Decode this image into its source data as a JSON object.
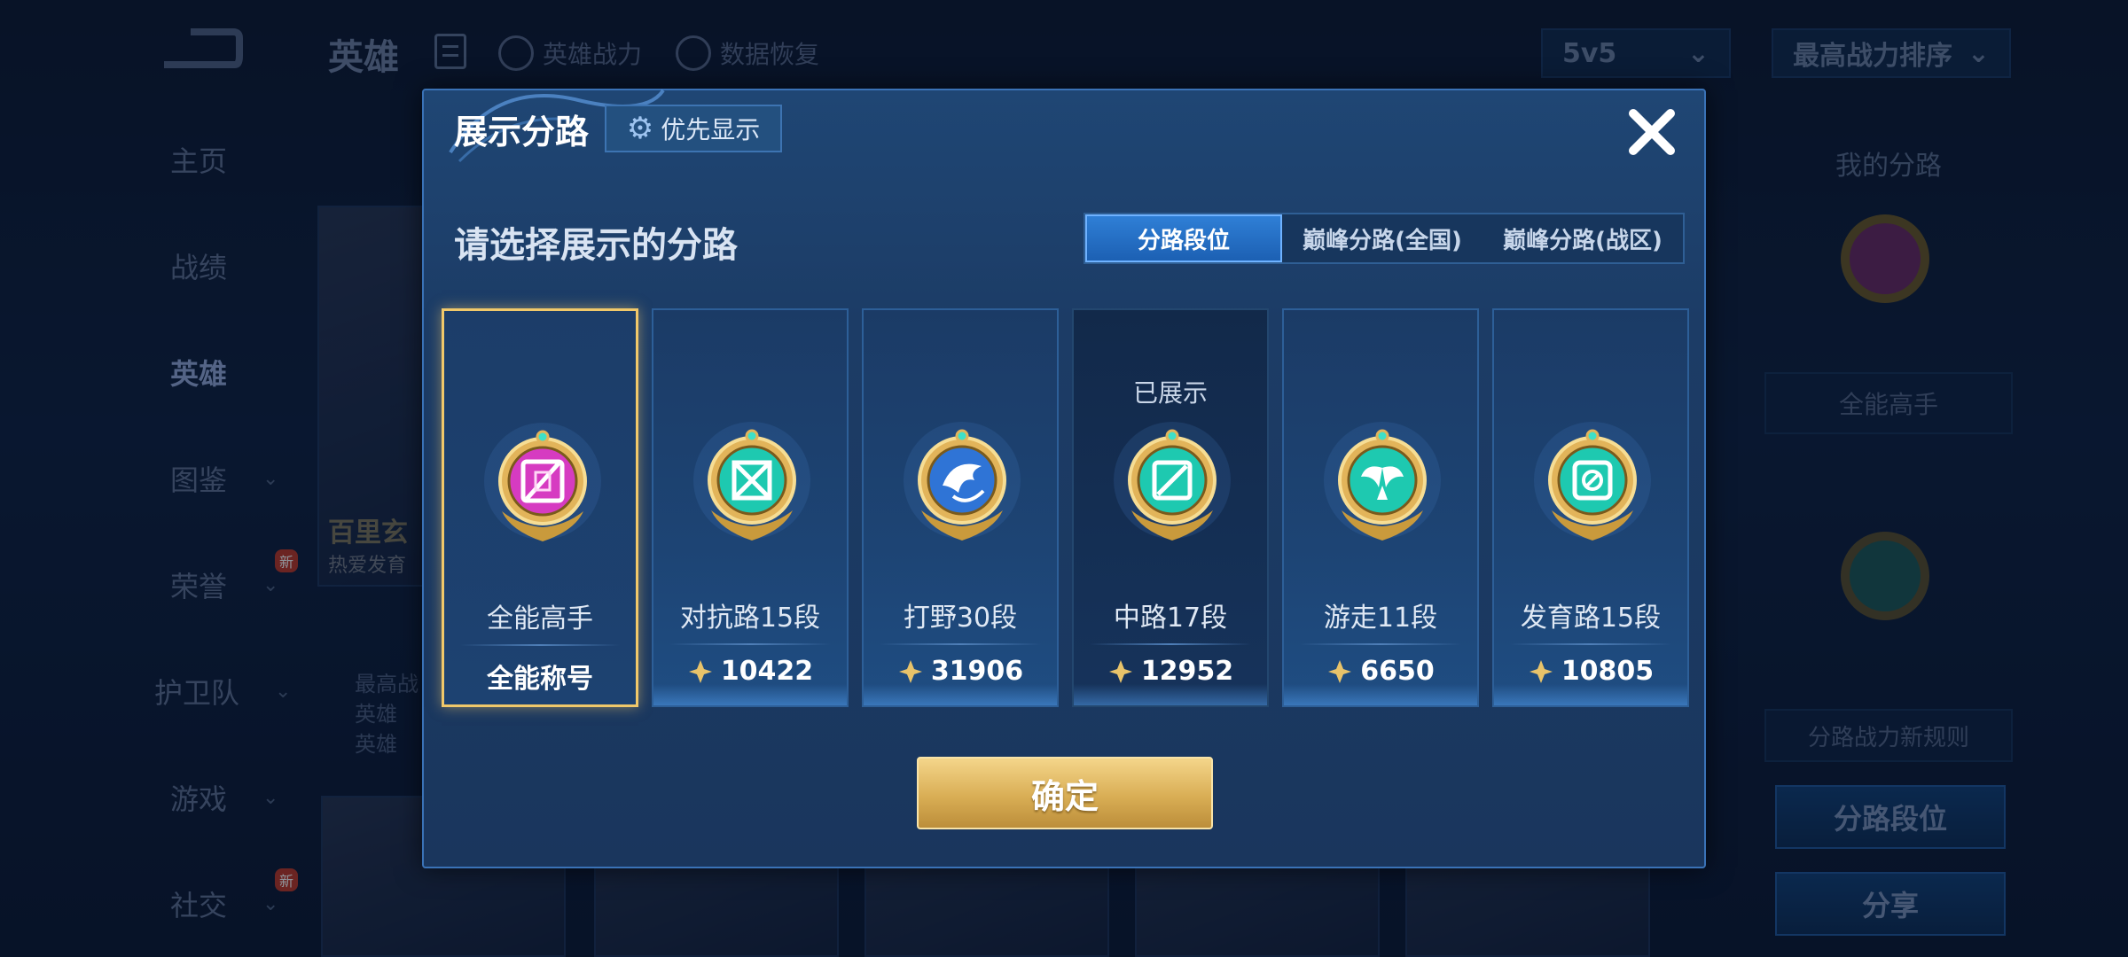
{
  "background": {
    "top_title": "英雄",
    "top_items": [
      "英雄战力",
      "数据恢复"
    ],
    "mode_select": "5v5",
    "sort_select": "最高战力排序",
    "sidebar": [
      {
        "label": "主页",
        "new": false,
        "chevron": false
      },
      {
        "label": "战绩",
        "new": false,
        "chevron": false
      },
      {
        "label": "英雄",
        "new": false,
        "chevron": false,
        "active": true
      },
      {
        "label": "图鉴",
        "new": false,
        "chevron": true
      },
      {
        "label": "荣誉",
        "new": true,
        "chevron": true
      },
      {
        "label": "护卫队",
        "new": false,
        "chevron": true
      },
      {
        "label": "游戏",
        "new": false,
        "chevron": true
      },
      {
        "label": "社交",
        "new": true,
        "chevron": true
      }
    ],
    "new_badge": "新",
    "hero_card_name": "百里玄",
    "hero_card_sub": "热爱发育",
    "hero_stats": [
      "最高战",
      "英雄",
      "英雄"
    ],
    "right_panel": {
      "title": "我的分路",
      "badge1": "全能高手",
      "rule": "分路战力新规则",
      "btn_lane": "分路段位",
      "btn_share": "分享"
    }
  },
  "dialog": {
    "title": "展示分路",
    "preference_button": "优先显示",
    "subtitle": "请选择展示的分路",
    "tabs": [
      {
        "label": "分路段位",
        "active": true
      },
      {
        "label": "巅峰分路(全国)",
        "active": false
      },
      {
        "label": "巅峰分路(战区)",
        "active": false
      }
    ],
    "cards": [
      {
        "label": "全能高手",
        "value": "全能称号",
        "selected": true,
        "shown": "",
        "medal_color": "#d63bc1",
        "icon": "allround-icon",
        "value_is_power": false
      },
      {
        "label": "对抗路15段",
        "value": "10422",
        "selected": false,
        "shown": "",
        "medal_color": "#1ec9b0",
        "icon": "clash-lane-icon",
        "value_is_power": true
      },
      {
        "label": "打野30段",
        "value": "31906",
        "selected": false,
        "shown": "",
        "medal_color": "#2f74d6",
        "icon": "jungle-icon",
        "value_is_power": true
      },
      {
        "label": "中路17段",
        "value": "12952",
        "selected": false,
        "shown": "已展示",
        "medal_color": "#1ec9b0",
        "icon": "mid-lane-icon",
        "value_is_power": true
      },
      {
        "label": "游走11段",
        "value": "6650",
        "selected": false,
        "shown": "",
        "medal_color": "#1ec9b0",
        "icon": "roam-icon",
        "value_is_power": true
      },
      {
        "label": "发育路15段",
        "value": "10805",
        "selected": false,
        "shown": "",
        "medal_color": "#1ec9b0",
        "icon": "farm-lane-icon",
        "value_is_power": true
      }
    ],
    "confirm": "确定"
  }
}
